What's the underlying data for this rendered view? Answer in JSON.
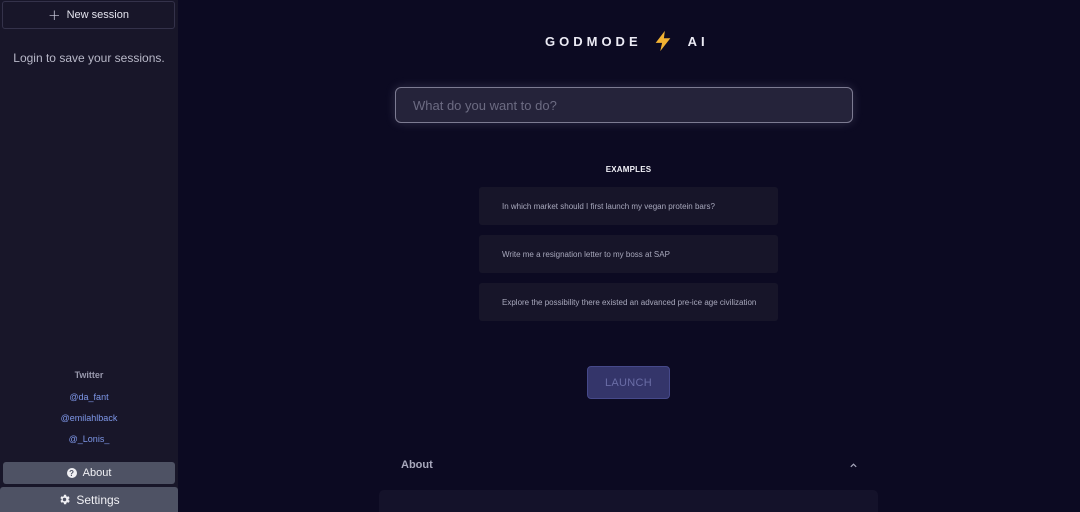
{
  "sidebar": {
    "new_session_label": "New session",
    "login_hint": "Login to save your sessions.",
    "twitter_title": "Twitter",
    "twitter_handles": [
      "@da_fant",
      "@emilahlback",
      "@_Lonis_"
    ],
    "about_label": "About",
    "settings_label": "Settings"
  },
  "header": {
    "brand_left": "GODMODE",
    "brand_right": "AI",
    "brand_icon": "lightning-bolt-icon"
  },
  "search": {
    "placeholder": "What do you want to do?",
    "value": ""
  },
  "examples": {
    "title": "EXAMPLES",
    "items": [
      "In which market should I first launch my vegan protein bars?",
      "Write me a resignation letter to my boss at SAP",
      "Explore the possibility there existed an advanced pre-ice age civilization"
    ]
  },
  "launch_label": "LAUNCH",
  "about_section": {
    "title": "About",
    "state": "expanded"
  },
  "colors": {
    "background": "#0c0a22",
    "sidebar": "#181629",
    "accent_button": "#34356a",
    "link": "#7e97e8",
    "bolt": "#f2b233"
  }
}
